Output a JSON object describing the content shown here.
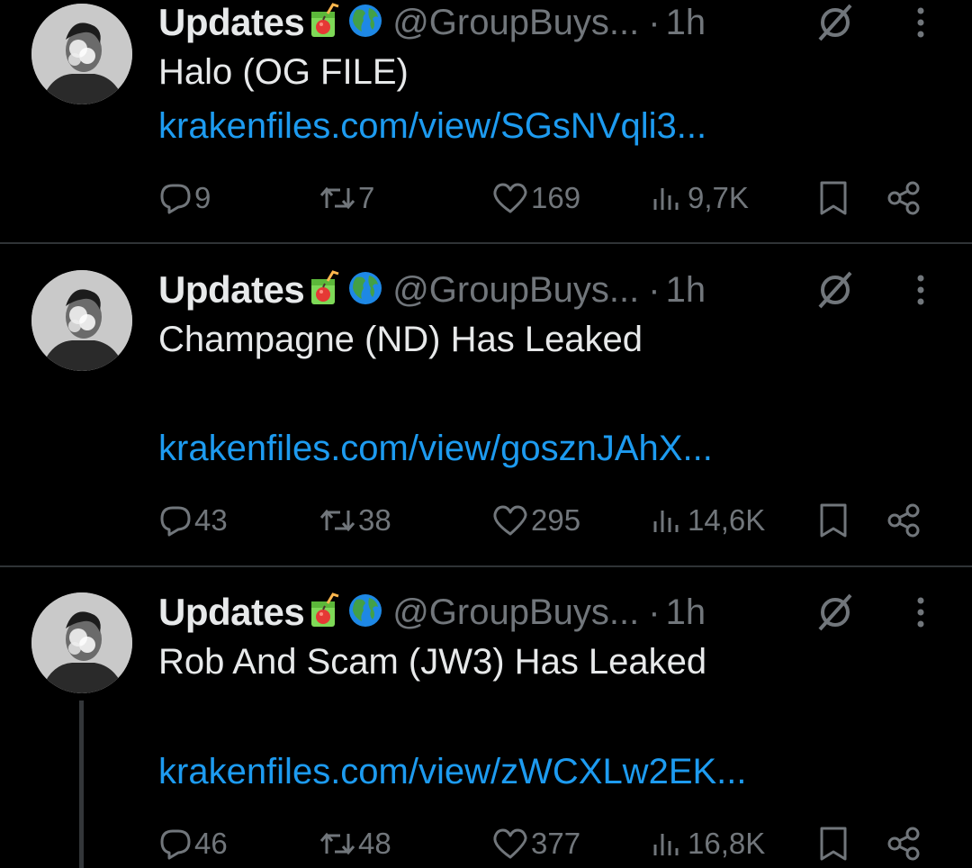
{
  "tweets": [
    {
      "name": "Updates",
      "handle": "@GroupBuys...",
      "separator": "·",
      "time": "1h",
      "text": "Halo (OG FILE)",
      "link": "krakenfiles.com/view/SGsNVqli3...",
      "replies": "9",
      "reposts": "7",
      "likes": "169",
      "views": "9,7K"
    },
    {
      "name": "Updates",
      "handle": "@GroupBuys...",
      "separator": "·",
      "time": "1h",
      "text": "Champagne (ND) Has Leaked",
      "link": "krakenfiles.com/view/gosznJAhX...",
      "replies": "43",
      "reposts": "38",
      "likes": "295",
      "views": "14,6K"
    },
    {
      "name": "Updates",
      "handle": "@GroupBuys...",
      "separator": "·",
      "time": "1h",
      "text": "Rob And Scam (JW3) Has Leaked",
      "link": "krakenfiles.com/view/zWCXLw2EK...",
      "replies": "46",
      "reposts": "48",
      "likes": "377",
      "views": "16,8K"
    }
  ],
  "icons": {
    "name_emojis": [
      "juice-box-icon",
      "globe-icon"
    ],
    "header": [
      "null-sign-icon",
      "more-vertical-icon"
    ],
    "actions": [
      "reply-icon",
      "repost-icon",
      "like-icon",
      "views-icon",
      "bookmark-icon",
      "share-icon"
    ]
  },
  "colors": {
    "background": "#000000",
    "text": "#e7e9ea",
    "secondary": "#71767b",
    "link": "#1d9bf0",
    "divider": "#2f3336"
  }
}
